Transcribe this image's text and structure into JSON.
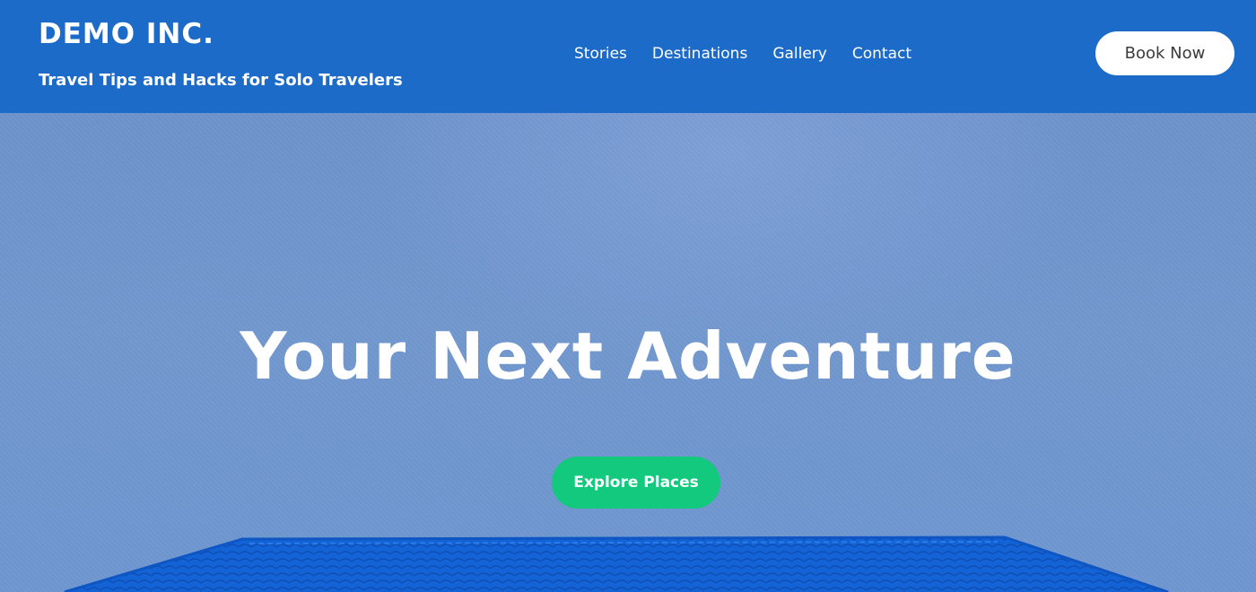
{
  "header": {
    "brand_title": "DEMO INC.",
    "tagline": "Travel Tips and Hacks for Solo Travelers",
    "nav": [
      {
        "label": "Stories"
      },
      {
        "label": "Destinations"
      },
      {
        "label": "Gallery"
      },
      {
        "label": "Contact"
      }
    ],
    "cta_label": "Book Now"
  },
  "hero": {
    "headline": "Your Next Adventure",
    "cta_label": "Explore Places"
  },
  "colors": {
    "header_bg": "#1d6bc9",
    "hero_bg": "#6f97d0",
    "explore_button_bg": "#12c97e",
    "book_button_bg": "#ffffff",
    "roof_blue": "#1463d6"
  },
  "icons": {
    "hero_image": "boat-roof-image"
  }
}
